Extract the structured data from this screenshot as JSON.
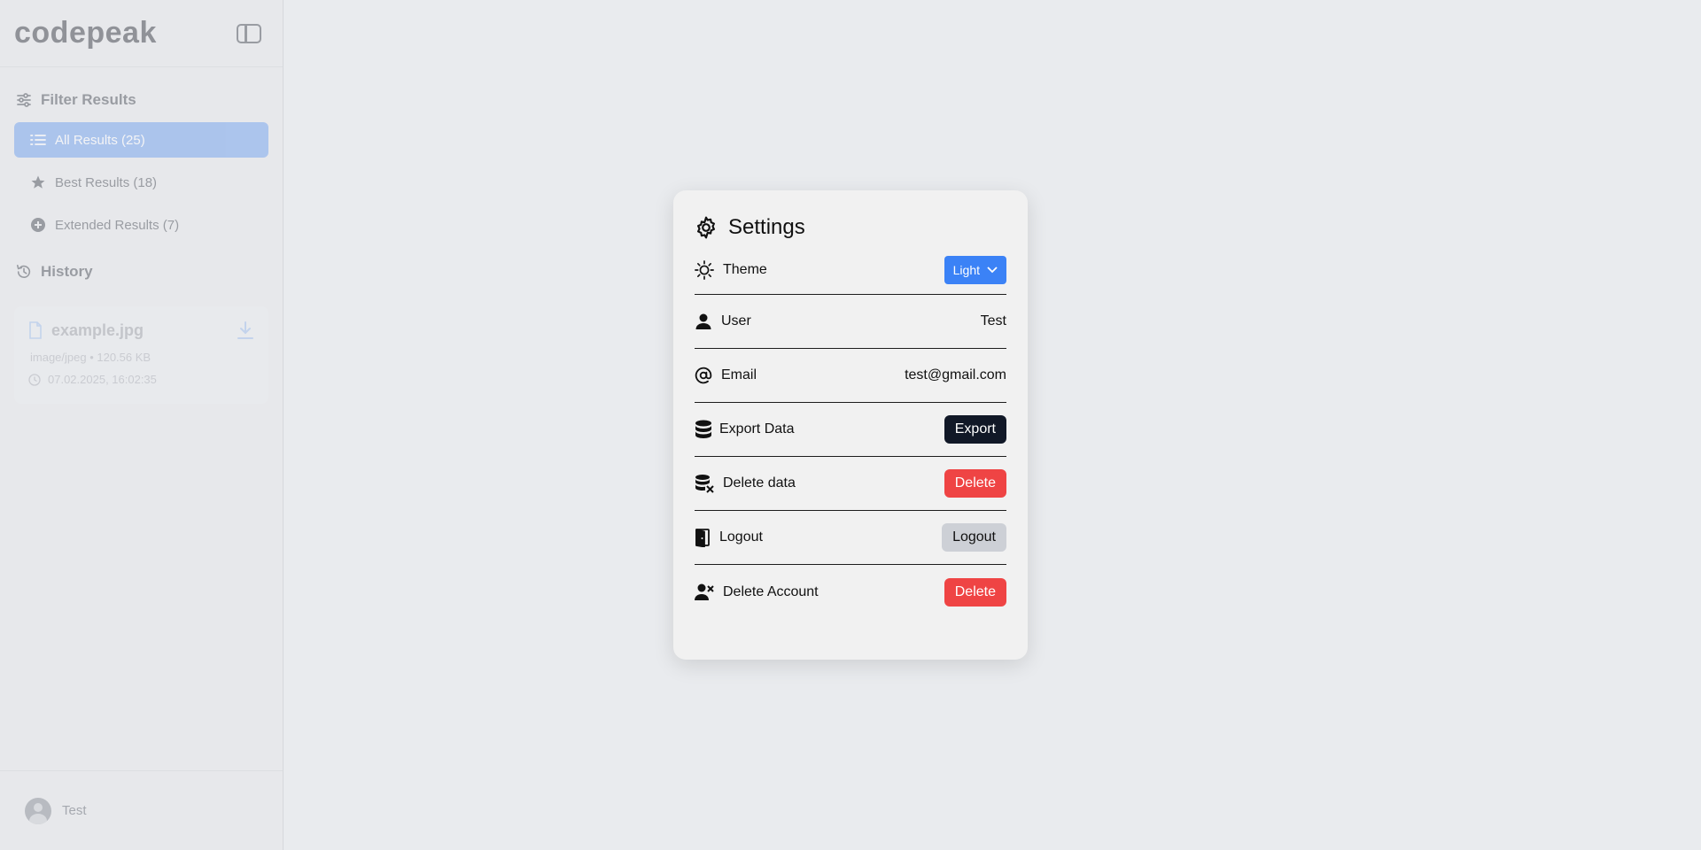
{
  "sidebar": {
    "logo": "codepeak",
    "filter_title": "Filter Results",
    "filters": [
      {
        "label": "All Results (25)",
        "active": true
      },
      {
        "label": "Best Results (18)",
        "active": false
      },
      {
        "label": "Extended Results (7)",
        "active": false
      }
    ],
    "history_title": "History",
    "history": [
      {
        "filename": "example.jpg",
        "meta": "image/jpeg • 120.56 KB",
        "time": "07.02.2025, 16:02:35"
      }
    ],
    "footer_user": "Test"
  },
  "settings": {
    "title": "Settings",
    "theme_label": "Theme",
    "theme_value": "Light",
    "user_label": "User",
    "user_value": "Test",
    "email_label": "Email",
    "email_value": "test@gmail.com",
    "export_label": "Export Data",
    "export_button": "Export",
    "delete_data_label": "Delete data",
    "delete_data_button": "Delete",
    "logout_label": "Logout",
    "logout_button": "Logout",
    "delete_account_label": "Delete Account",
    "delete_account_button": "Delete"
  },
  "colors": {
    "accent": "#3b82f6",
    "active_filter": "#7ba8ee",
    "danger": "#ef4444",
    "dark_button": "#111827"
  }
}
